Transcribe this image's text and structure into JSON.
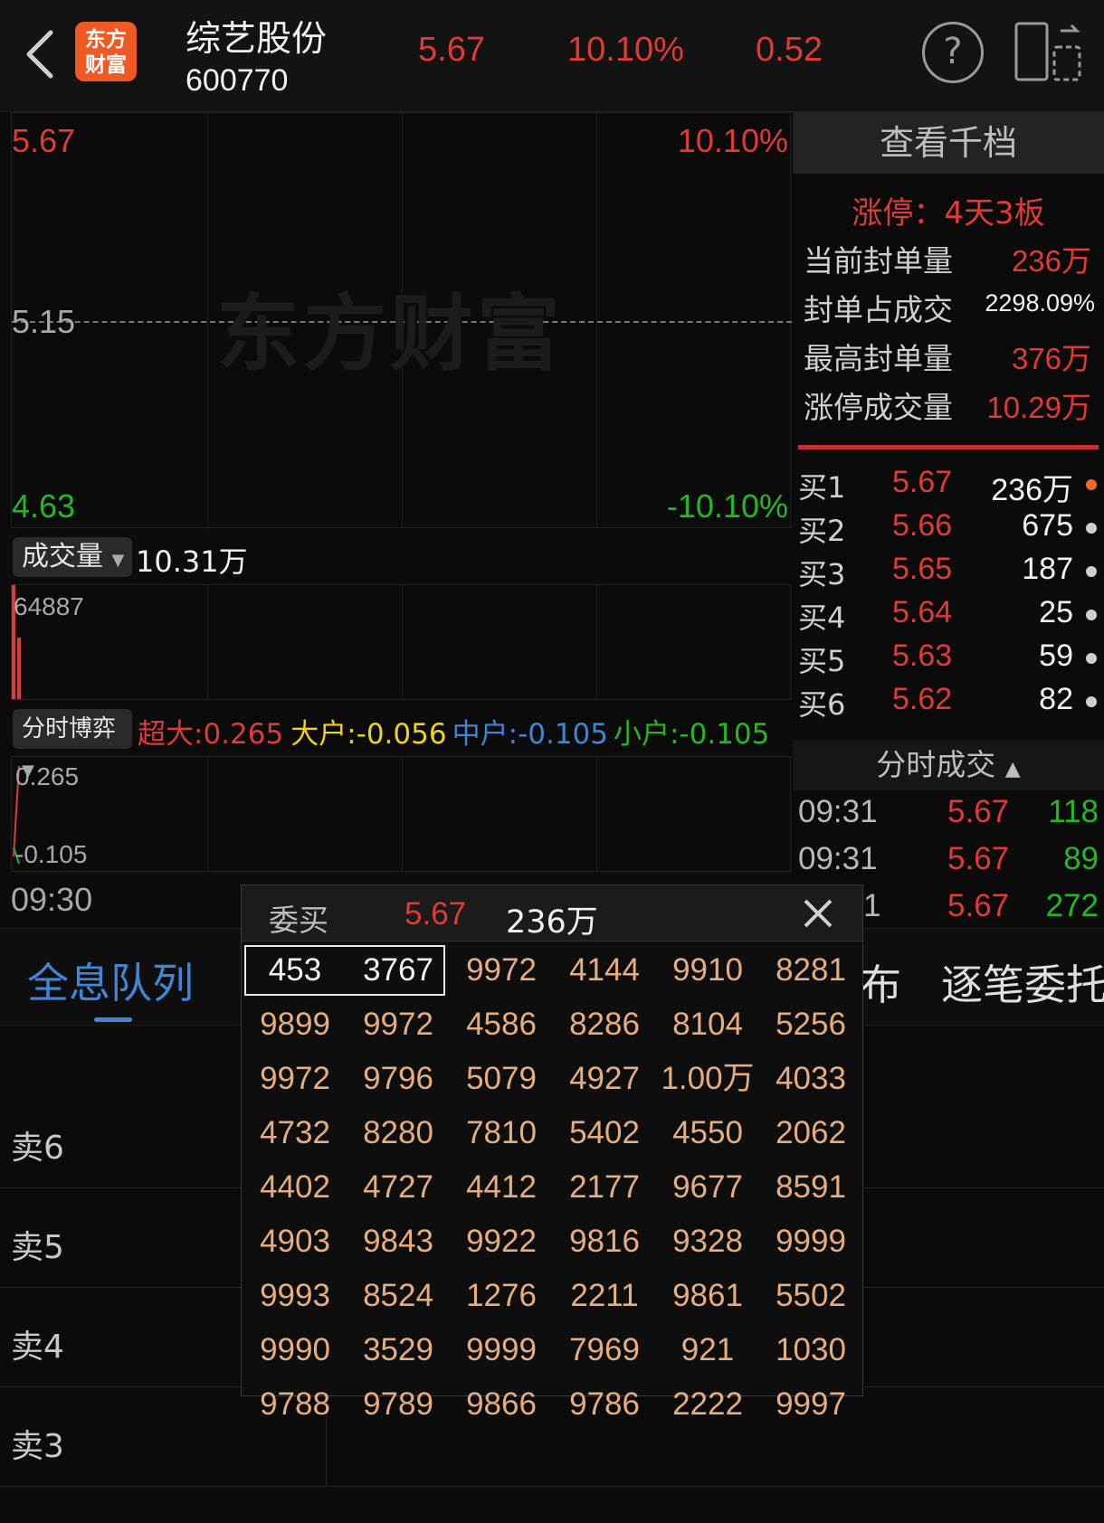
{
  "header": {
    "logo_line1": "东方",
    "logo_line2": "财富",
    "stock_name": "综艺股份",
    "stock_code": "600770",
    "price": "5.67",
    "change_pct": "10.10%",
    "change_amt": "0.52",
    "help_label": "?"
  },
  "chart": {
    "top_price": "5.67",
    "top_pct": "10.10%",
    "mid_price": "5.15",
    "bottom_price": "4.63",
    "bottom_pct": "-10.10%",
    "watermark": "东方财富",
    "volume_selector": "成交量",
    "volume_value": "10.31万",
    "volume_axis_max": "64887",
    "game_selector": "分时博弈",
    "game_super": "超大:0.265",
    "game_big": "大户:-0.056",
    "game_mid": "中户:-0.105",
    "game_small": "小户:-0.105",
    "game_axis_top": "0.265",
    "game_axis_bottom": "-0.105",
    "time_start": "09:30"
  },
  "right_panel": {
    "view_button": "查看千档",
    "limit_title": "涨停：4天3板",
    "stats": [
      {
        "label": "当前封单量",
        "value": "236万"
      },
      {
        "label": "封单占成交",
        "value": "2298.09%"
      },
      {
        "label": "最高封单量",
        "value": "376万"
      },
      {
        "label": "涨停成交量",
        "value": "10.29万"
      }
    ],
    "book": [
      {
        "label": "买1",
        "price": "5.67",
        "qty": "236万"
      },
      {
        "label": "买2",
        "price": "5.66",
        "qty": "675"
      },
      {
        "label": "买3",
        "price": "5.65",
        "qty": "187"
      },
      {
        "label": "买4",
        "price": "5.64",
        "qty": "25"
      },
      {
        "label": "买5",
        "price": "5.63",
        "qty": "59"
      },
      {
        "label": "买6",
        "price": "5.62",
        "qty": "82"
      }
    ],
    "trades_header": "分时成交",
    "trades": [
      {
        "time": "09:31",
        "price": "5.67",
        "vol": "118"
      },
      {
        "time": "09:31",
        "price": "5.67",
        "vol": "89"
      },
      {
        "time": "1",
        "price": "5.67",
        "vol": "272"
      }
    ]
  },
  "tabs": {
    "queue": "全息队列",
    "partial_right": "布",
    "order_by_order": "逐笔委托"
  },
  "sell_rows": [
    "卖6",
    "卖5",
    "卖4",
    "卖3"
  ],
  "popup": {
    "title": "委买",
    "price": "5.67",
    "volume": "236万",
    "cells": [
      "453",
      "3767",
      "9972",
      "4144",
      "9910",
      "8281",
      "9899",
      "9972",
      "4586",
      "8286",
      "8104",
      "5256",
      "9972",
      "9796",
      "5079",
      "4927",
      "1.00万",
      "4033",
      "4732",
      "8280",
      "7810",
      "5402",
      "4550",
      "2062",
      "4402",
      "4727",
      "4412",
      "2177",
      "9677",
      "8591",
      "4903",
      "9843",
      "9922",
      "9816",
      "9328",
      "9999",
      "9993",
      "8524",
      "1276",
      "2211",
      "9861",
      "5502",
      "9990",
      "3529",
      "9999",
      "7969",
      "921",
      "1030",
      "9788",
      "9789",
      "9866",
      "9786",
      "2222",
      "9997"
    ]
  },
  "colors": {
    "up": "#e03a36",
    "down": "#23b823",
    "accent_blue": "#3f86d6",
    "queue_gold": "#e6ad7e",
    "logo_orange": "#ef5a24"
  }
}
